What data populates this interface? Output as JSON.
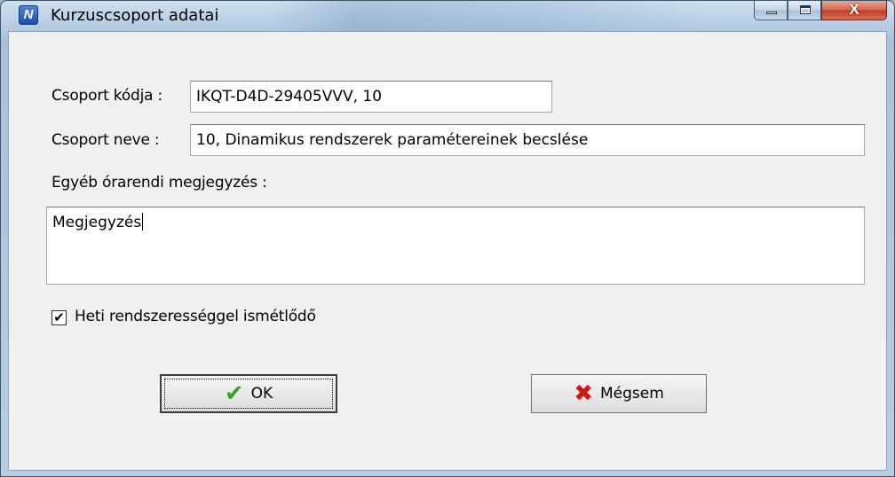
{
  "window": {
    "title": "Kurzuscsoport adatai",
    "icon": "app-logo-icon",
    "icon_letter": "N",
    "close_glyph": "X"
  },
  "form": {
    "code_label": "Csoport kódja :",
    "code_value": "IKQT-D4D-29405VVV, 10",
    "name_label": "Csoport neve :",
    "name_value": "10, Dinamikus rendszerek paramétereinek becslése",
    "note_label": "Egyéb órarendi megjegyzés :",
    "note_value": "Megjegyzés",
    "weekly_label": "Heti rendszerességgel ismétlődő",
    "weekly_checked": true,
    "check_mark": "✔"
  },
  "buttons": {
    "ok_label": "OK",
    "ok_icon": "checkmark-icon",
    "ok_glyph": "✔",
    "cancel_label": "Mégsem",
    "cancel_icon": "red-x-icon",
    "cancel_glyph": "✖"
  },
  "colors": {
    "ok_icon": "#2fa52f",
    "cancel_icon": "#d01818",
    "close_button": "#c13b22"
  }
}
